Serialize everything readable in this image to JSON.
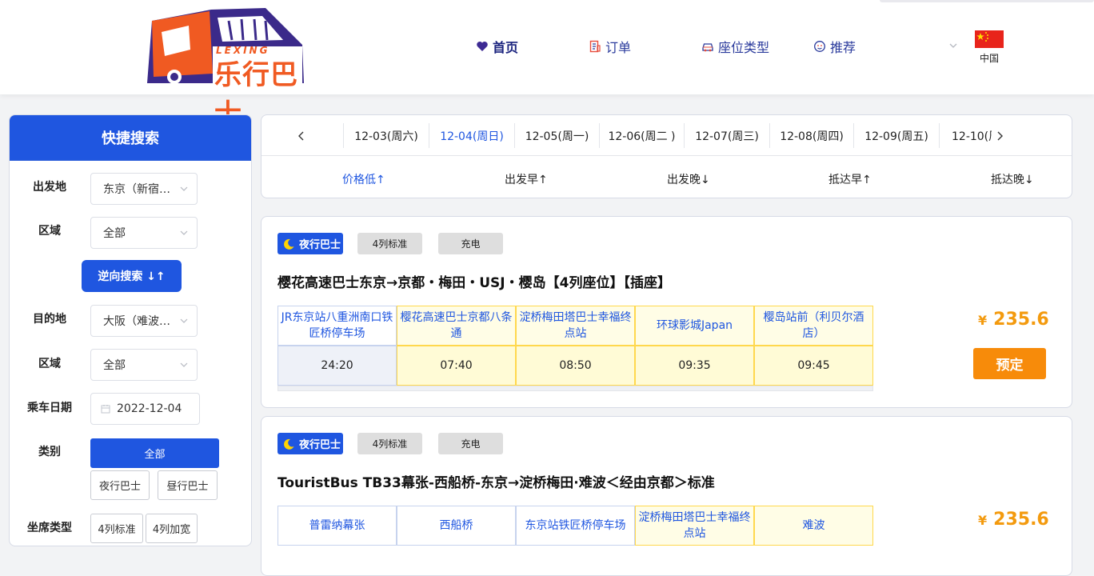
{
  "header": {
    "logo": {
      "brand_cn": "乐行巴士",
      "brand_en": "LEXING"
    },
    "nav": [
      {
        "label": "首页",
        "icon": "heart-icon"
      },
      {
        "label": "订单",
        "icon": "receipt-icon"
      },
      {
        "label": "座位类型",
        "icon": "car-icon"
      },
      {
        "label": "推荐",
        "icon": "smile-icon"
      }
    ],
    "language": {
      "label": "中国",
      "icon": "china-flag-icon"
    }
  },
  "sidebar": {
    "title": "快捷搜索",
    "departure": {
      "label": "出发地",
      "value": "东京（新宿…"
    },
    "departure_area": {
      "label": "区域",
      "value": "全部"
    },
    "reverse_button": "逆向搜索 ↓↑",
    "destination": {
      "label": "目的地",
      "value": "大阪（难波…"
    },
    "destination_area": {
      "label": "区域",
      "value": "全部"
    },
    "date": {
      "label": "乘车日期",
      "value": "2022-12-04"
    },
    "category": {
      "label": "类别",
      "options": [
        "全部",
        "夜行巴士",
        "昼行巴士"
      ],
      "selected": "全部"
    },
    "seat_type": {
      "label": "坐席类型",
      "options": [
        "4列标准",
        "4列加宽"
      ]
    }
  },
  "dates": {
    "tabs": [
      "12-03(周六)",
      "12-04(周日)",
      "12-05(周一)",
      "12-06(周二 )",
      "12-07(周三)",
      "12-08(周四)",
      "12-09(周五)",
      "12-10(周"
    ],
    "active_index": 1
  },
  "sort": {
    "options": [
      "价格低↑",
      "出发早↑",
      "出发晚↓",
      "抵达早↑",
      "抵达晚↓"
    ],
    "active_index": 0
  },
  "results": [
    {
      "badges": [
        "夜行巴士",
        "4列标准",
        "充电"
      ],
      "title": "樱花高速巴士东京→京都・梅田・USJ・樱岛【4列座位】【插座】",
      "stops": [
        {
          "name": "JR东京站八重洲南口铁匠桥停车场",
          "time": "24:20"
        },
        {
          "name": "樱花高速巴士京都八条通",
          "time": "07:40"
        },
        {
          "name": "淀桥梅田塔巴士幸福终点站",
          "time": "08:50"
        },
        {
          "name": "环球影城Japan",
          "time": "09:35"
        },
        {
          "name": "樱岛站前（利贝尔酒店）",
          "time": "09:45"
        }
      ],
      "price_symbol": "¥",
      "price": "235.6",
      "book_label": "预定"
    },
    {
      "badges": [
        "夜行巴士",
        "4列标准",
        "充电"
      ],
      "title": "TouristBus TB33幕张-西船桥-东京→淀桥梅田·难波＜经由京都＞标准",
      "stops": [
        {
          "name": "普雷纳幕张"
        },
        {
          "name": "西船桥"
        },
        {
          "name": "东京站铁匠桥停车场"
        },
        {
          "name": "淀桥梅田塔巴士幸福终点站"
        },
        {
          "name": "难波"
        }
      ],
      "price_symbol": "¥",
      "price": "235.6"
    }
  ],
  "colors": {
    "primary": "#1f56e0",
    "accent": "#f78b0a",
    "price": "#f39a0e"
  }
}
